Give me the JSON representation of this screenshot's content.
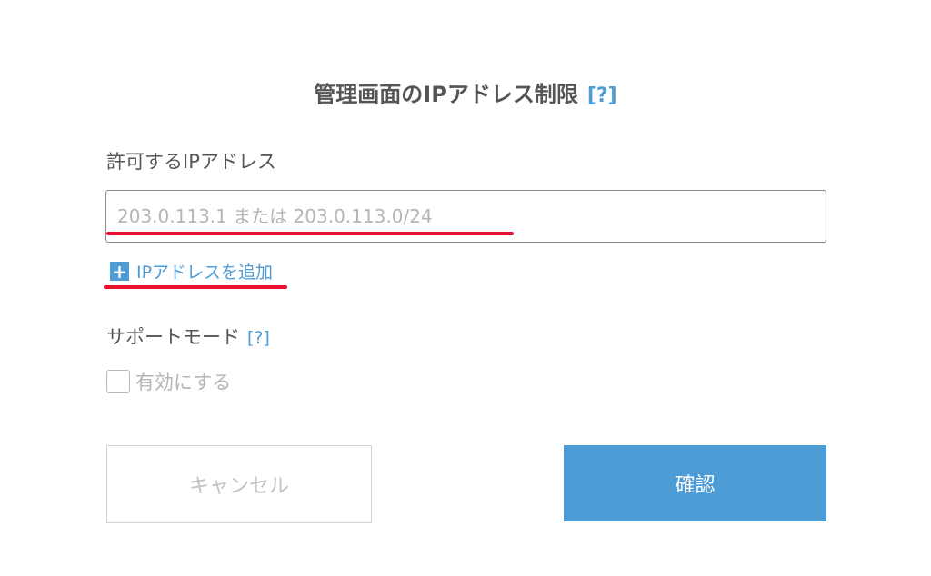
{
  "header": {
    "title": "管理画面のIPアドレス制限",
    "help_link": "[?]"
  },
  "ip_section": {
    "label": "許可するIPアドレス",
    "input_placeholder": "203.0.113.1 または 203.0.113.0/24",
    "input_value": "",
    "add_icon": "plus-icon",
    "add_label": "IPアドレスを追加"
  },
  "support_section": {
    "label": "サポートモード",
    "help_link": "[?]",
    "checkbox_label": "有効にする",
    "checked": false
  },
  "buttons": {
    "cancel_label": "キャンセル",
    "confirm_label": "確認"
  },
  "colors": {
    "accent": "#4e9cd5",
    "highlight_underline": "#e8102e",
    "text": "#555555",
    "disabled_text": "#b5b5b5"
  }
}
